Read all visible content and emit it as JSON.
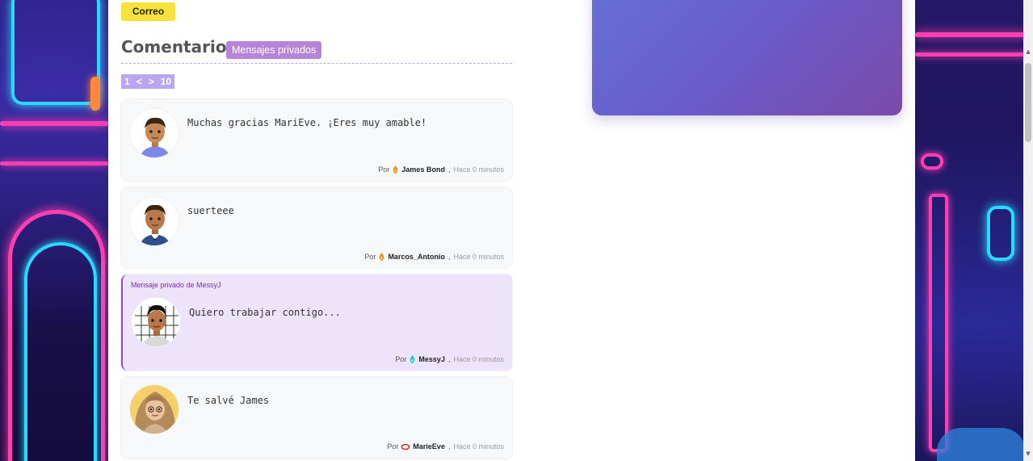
{
  "buttons": {
    "correo": "Correo"
  },
  "comments_section": {
    "title": "Comentarios",
    "private_messages_badge": "Mensajes privados"
  },
  "pager": {
    "first": "1",
    "prev": "<",
    "next": ">",
    "last": "10"
  },
  "comments": [
    {
      "text": "Muchas gracias MariEve. ¡Eres muy amable!",
      "by_label": "Por",
      "user": "James Bond",
      "separator": ",",
      "time": "Hace 0 minutos",
      "private": false
    },
    {
      "text": "suerteee",
      "by_label": "Por",
      "user": "Marcos_Antonio",
      "separator": ",",
      "time": "Hace 0 minutos",
      "private": false
    },
    {
      "private_label": "Mensaje privado de MessyJ",
      "text": "Quiero trabajar contigo...",
      "by_label": "Por",
      "user": "MessyJ",
      "separator": ",",
      "time": "Hace 0 minutos",
      "private": true
    },
    {
      "text": "Te salvé James",
      "by_label": "Por",
      "user": "MarieEve",
      "separator": ",",
      "time": "Hace 0 minutos",
      "private": false
    }
  ],
  "colors": {
    "correo_button": "#f7e23b",
    "badge": "#b785d7",
    "pager": "#b8a6f2",
    "private_bg": "#ede3fb",
    "private_accent": "#8f4fc9"
  }
}
